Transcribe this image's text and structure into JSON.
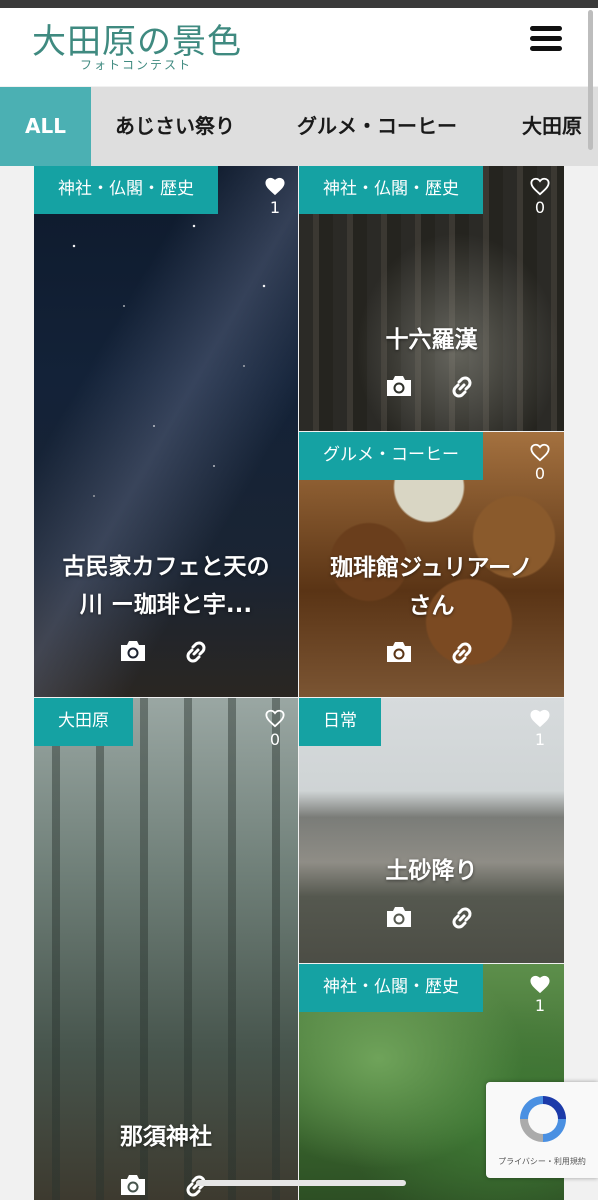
{
  "header": {
    "logo_main": "大田原の景色",
    "logo_sub": "フォトコンテスト"
  },
  "filters": [
    {
      "label": "ALL",
      "active": true
    },
    {
      "label": "あじさい祭り",
      "active": false
    },
    {
      "label": "グルメ・コーヒー",
      "active": false
    },
    {
      "label": "大田原",
      "active": false
    }
  ],
  "cards": [
    {
      "tag": "神社・仏閣・歴史",
      "likes": "1",
      "liked": true,
      "title": "古民家カフェと天の川 ー珈琲と宇..."
    },
    {
      "tag": "神社・仏閣・歴史",
      "likes": "0",
      "liked": false,
      "title": "十六羅漢"
    },
    {
      "tag": "グルメ・コーヒー",
      "likes": "0",
      "liked": false,
      "title": "珈琲館ジュリアーノさん"
    },
    {
      "tag": "大田原",
      "likes": "0",
      "liked": false,
      "title": "那須神社"
    },
    {
      "tag": "日常",
      "likes": "1",
      "liked": true,
      "title": "土砂降り"
    },
    {
      "tag": "神社・仏閣・歴史",
      "likes": "1",
      "liked": true,
      "title": ""
    }
  ],
  "recaptcha": {
    "text": "プライバシー・利用規約"
  },
  "colors": {
    "accent": "#15a2a3",
    "filter_active": "#4bb0b3",
    "logo": "#3f8a80"
  }
}
